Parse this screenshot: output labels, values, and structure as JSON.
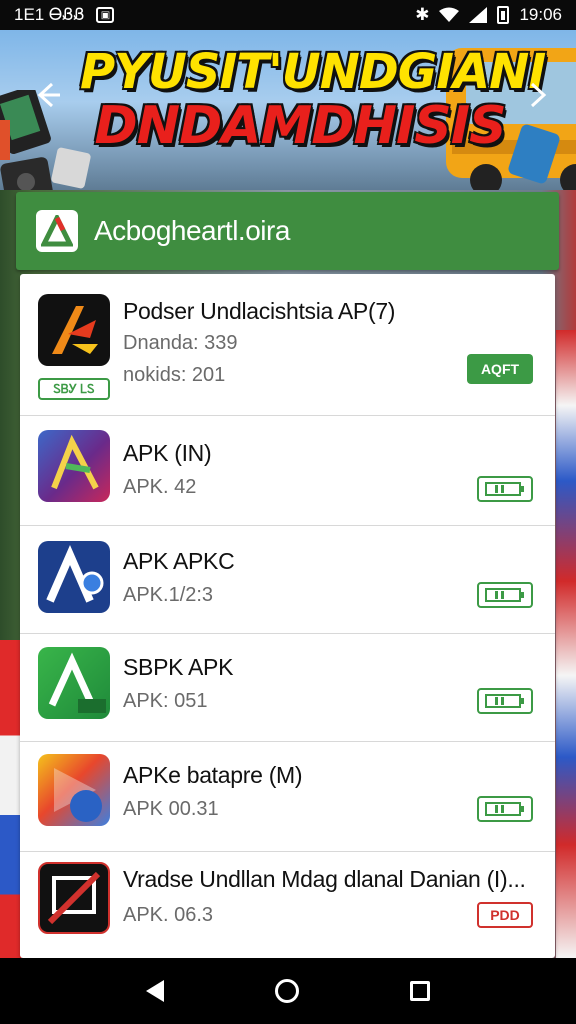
{
  "status_bar": {
    "left_text": "1E1 ᎾᏰᏰ",
    "time": "19:06"
  },
  "banner": {
    "title_line1": "PYUSIT'UNDGIANI",
    "title_line2": "DNDAMDHISIS"
  },
  "header": {
    "title": "Acbogheartl.oira"
  },
  "apps": [
    {
      "name": "Podser Undlacishtsia AP(7)",
      "line1": "Dnanda: 339",
      "line2": "nokids: 201",
      "button": "AQFT",
      "tag": "ᏚᏴᎩ ᏞᏚ"
    },
    {
      "name": "APK (IN)",
      "line1": "APK. 42",
      "button": ""
    },
    {
      "name": "APK APKC",
      "line1": "APK.1/2:3",
      "button": ""
    },
    {
      "name": "SBPK APK",
      "line1": "APK: 051",
      "button": ""
    },
    {
      "name": "APKe batapre (M)",
      "line1": "APK 00.31",
      "button": ""
    },
    {
      "name": "Vradse Undllan Mdag dlanal Danian (I)...",
      "line1": "APK. 06.3",
      "button": "PDD"
    }
  ],
  "colors": {
    "header_green": "#3f8d40",
    "button_green": "#3c9a45",
    "warning_red": "#d0312d",
    "banner_yellow": "#ffe200",
    "banner_red": "#e9201c"
  },
  "icons": {
    "prev": "chevron-left-icon",
    "next": "chevron-right-icon",
    "back": "back-icon",
    "home": "home-icon",
    "recent": "recent-apps-icon"
  }
}
